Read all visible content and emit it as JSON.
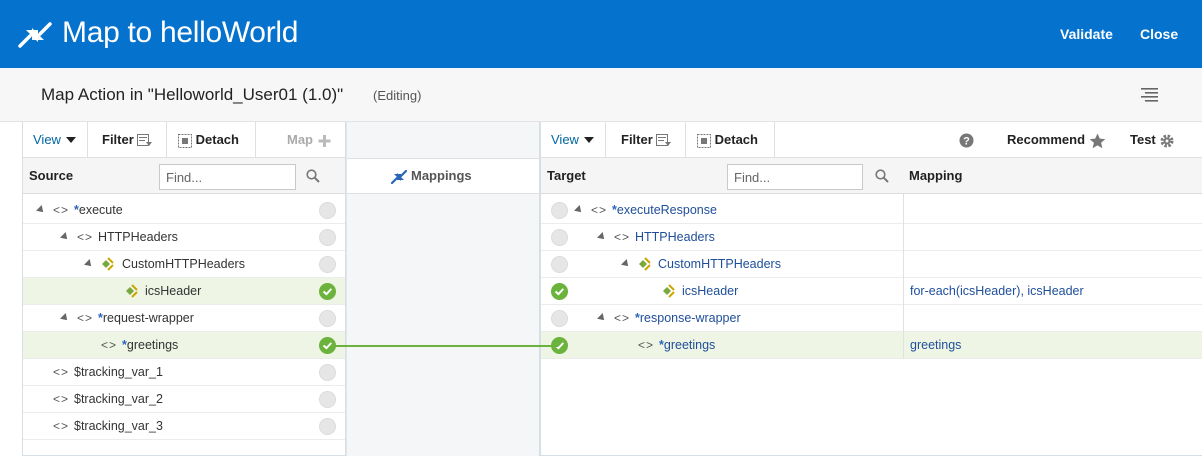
{
  "header": {
    "title": "Map to helloWorld",
    "validate_label": "Validate",
    "close_label": "Close",
    "bg_color": "#0572ce"
  },
  "subheader": {
    "title": "Map Action in \"Helloworld_User01 (1.0)\"",
    "status": "(Editing)"
  },
  "source_panel": {
    "toolbar": {
      "view": "View",
      "filter": "Filter",
      "detach": "Detach",
      "map": "Map"
    },
    "column_title": "Source",
    "find_placeholder": "Find...",
    "rows": [
      {
        "name": "execute",
        "required": true,
        "mapped": false
      },
      {
        "name": "HTTPHeaders",
        "required": false,
        "mapped": false
      },
      {
        "name": "CustomHTTPHeaders",
        "required": false,
        "mapped": false
      },
      {
        "name": "icsHeader",
        "required": false,
        "mapped": true
      },
      {
        "name": "request-wrapper",
        "required": true,
        "mapped": false
      },
      {
        "name": "greetings",
        "required": true,
        "mapped": true
      },
      {
        "name": "$tracking_var_1",
        "required": false,
        "mapped": false
      },
      {
        "name": "$tracking_var_2",
        "required": false,
        "mapped": false
      },
      {
        "name": "$tracking_var_3",
        "required": false,
        "mapped": false
      }
    ]
  },
  "mappings_panel": {
    "label": "Mappings"
  },
  "target_panel": {
    "toolbar": {
      "view": "View",
      "filter": "Filter",
      "detach": "Detach",
      "recommend": "Recommend",
      "test": "Test"
    },
    "column_title": "Target",
    "mapping_title": "Mapping",
    "find_placeholder": "Find...",
    "rows": [
      {
        "name": "executeResponse",
        "required": true,
        "mapped": false,
        "mapping": ""
      },
      {
        "name": "HTTPHeaders",
        "required": false,
        "mapped": false,
        "mapping": ""
      },
      {
        "name": "CustomHTTPHeaders",
        "required": false,
        "mapped": false,
        "mapping": ""
      },
      {
        "name": "icsHeader",
        "required": false,
        "mapped": true,
        "mapping": "for-each(icsHeader), icsHeader"
      },
      {
        "name": "response-wrapper",
        "required": true,
        "mapped": false,
        "mapping": ""
      },
      {
        "name": "greetings",
        "required": true,
        "mapped": true,
        "mapping": "greetings"
      }
    ]
  },
  "colors": {
    "mapped": "#6cb33e",
    "link": "#1f4e9a",
    "highlight_row": "#eef5e4"
  }
}
